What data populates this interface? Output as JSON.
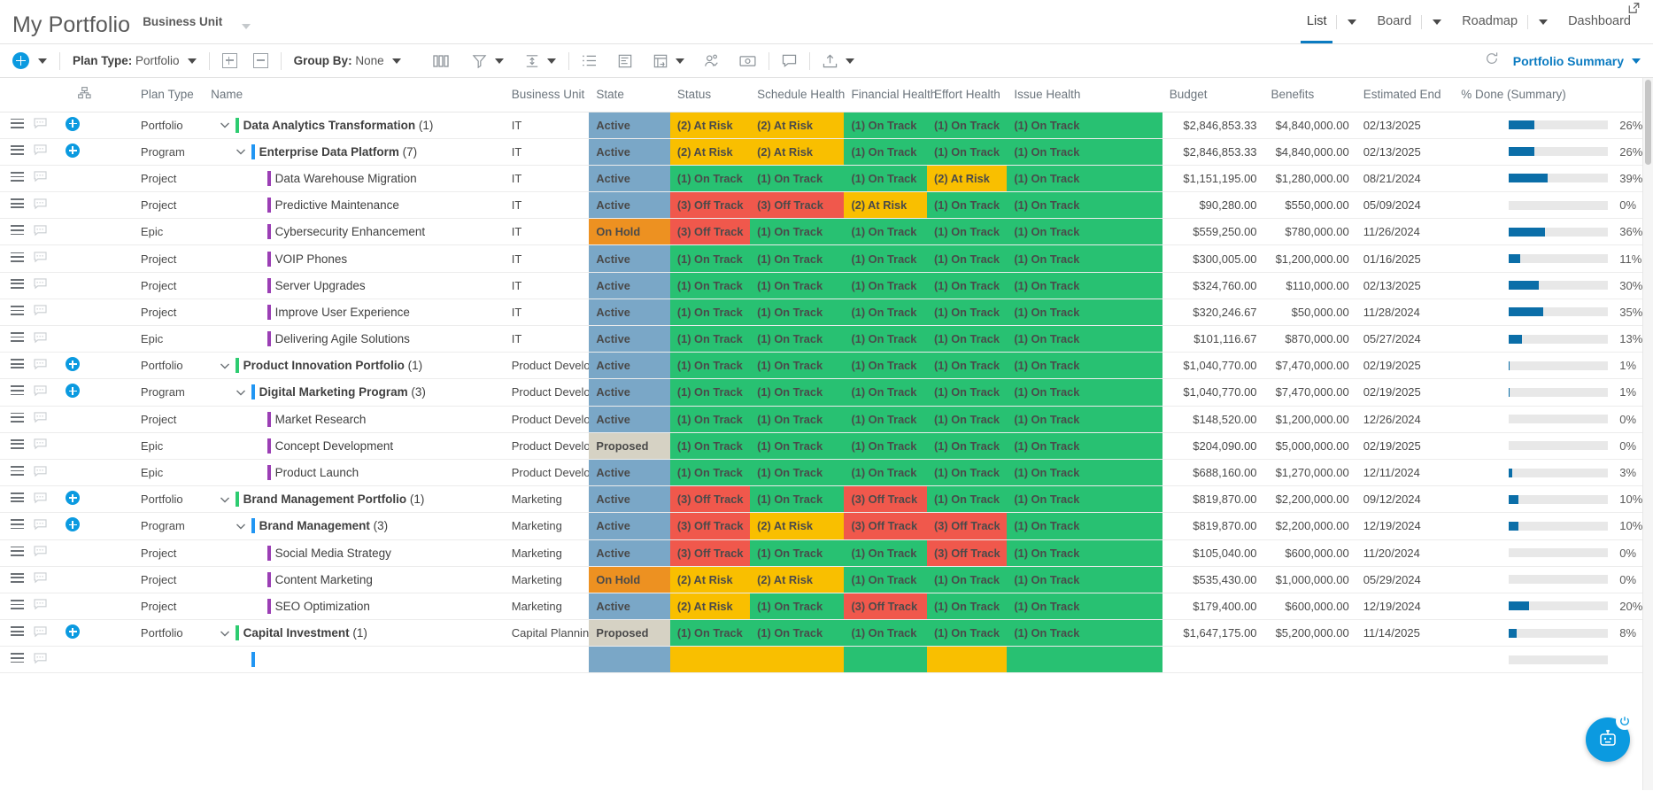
{
  "header": {
    "app_title": "My Portfolio",
    "business_unit_label": "Business Unit",
    "nav": [
      {
        "label": "List",
        "has_caret": true,
        "active": true
      },
      {
        "label": "Board",
        "has_caret": true,
        "active": false
      },
      {
        "label": "Roadmap",
        "has_caret": true,
        "active": false
      },
      {
        "label": "Dashboard",
        "has_caret": false,
        "active": false
      }
    ]
  },
  "toolbar": {
    "plan_type_prefix": "Plan Type:",
    "plan_type_value": "Portfolio",
    "group_by_prefix": "Group By:",
    "group_by_value": "None",
    "portfolio_summary": "Portfolio Summary",
    "icons": [
      "add-circle-icon",
      "columns-icon",
      "filter-icon",
      "row-height-icon",
      "list-icon",
      "baseline-icon",
      "card-view-icon",
      "resource-icon",
      "currency-icon",
      "comment-icon",
      "export-icon",
      "refresh-icon"
    ]
  },
  "table": {
    "columns": [
      {
        "key": "handle",
        "label": ""
      },
      {
        "key": "note",
        "label": ""
      },
      {
        "key": "add",
        "label": "hierarchy-icon"
      },
      {
        "key": "plan_type",
        "label": "Plan Type"
      },
      {
        "key": "name",
        "label": "Name"
      },
      {
        "key": "business_unit",
        "label": "Business Unit"
      },
      {
        "key": "state",
        "label": "State"
      },
      {
        "key": "status",
        "label": "Status"
      },
      {
        "key": "schedule_health",
        "label": "Schedule Health"
      },
      {
        "key": "financial_health",
        "label": "Financial Health"
      },
      {
        "key": "effort_health",
        "label": "Effort Health"
      },
      {
        "key": "issue_health",
        "label": "Issue Health"
      },
      {
        "key": "budget",
        "label": "Budget"
      },
      {
        "key": "benefits",
        "label": "Benefits"
      },
      {
        "key": "estimated_end",
        "label": "Estimated End"
      },
      {
        "key": "pct_done",
        "label": "% Done (Summary)"
      }
    ],
    "rows": [
      {
        "plan_type": "Portfolio",
        "name": "Data Analytics Transformation",
        "count": "(1)",
        "indent": 0,
        "expandable": true,
        "add": true,
        "group": true,
        "bar_color": "#2ecc71",
        "business_unit": "IT",
        "state": "Active",
        "state_color": "blue",
        "status": "(2) At Risk",
        "status_color": "yellow",
        "schedule_health": "(2) At Risk",
        "schedule_color": "yellow",
        "financial_health": "(1) On Track",
        "financial_color": "green",
        "effort_health": "(1) On Track",
        "effort_color": "green",
        "issue_health": "(1) On Track",
        "issue_color": "green",
        "budget": "$2,846,853.33",
        "benefits": "$4,840,000.00",
        "estimated_end": "02/13/2025",
        "pct_done": 26
      },
      {
        "plan_type": "Program",
        "name": "Enterprise Data Platform",
        "count": "(7)",
        "indent": 1,
        "expandable": true,
        "add": true,
        "group": true,
        "bar_color": "#2196f3",
        "business_unit": "IT",
        "state": "Active",
        "state_color": "blue",
        "status": "(2) At Risk",
        "status_color": "yellow",
        "schedule_health": "(2) At Risk",
        "schedule_color": "yellow",
        "financial_health": "(1) On Track",
        "financial_color": "green",
        "effort_health": "(1) On Track",
        "effort_color": "green",
        "issue_health": "(1) On Track",
        "issue_color": "green",
        "budget": "$2,846,853.33",
        "benefits": "$4,840,000.00",
        "estimated_end": "02/13/2025",
        "pct_done": 26
      },
      {
        "plan_type": "Project",
        "name": "Data Warehouse Migration",
        "count": "",
        "indent": 2,
        "expandable": false,
        "add": false,
        "group": false,
        "bar_color": "#9b3fb5",
        "business_unit": "IT",
        "state": "Active",
        "state_color": "blue",
        "status": "(1) On Track",
        "status_color": "green",
        "schedule_health": "(1) On Track",
        "schedule_color": "green",
        "financial_health": "(1) On Track",
        "financial_color": "green",
        "effort_health": "(2) At Risk",
        "effort_color": "yellow",
        "issue_health": "(1) On Track",
        "issue_color": "green",
        "budget": "$1,151,195.00",
        "benefits": "$1,280,000.00",
        "estimated_end": "08/21/2024",
        "pct_done": 39
      },
      {
        "plan_type": "Project",
        "name": "Predictive Maintenance",
        "count": "",
        "indent": 2,
        "expandable": false,
        "add": false,
        "group": false,
        "bar_color": "#9b3fb5",
        "business_unit": "IT",
        "state": "Active",
        "state_color": "blue",
        "status": "(3) Off Track",
        "status_color": "red",
        "schedule_health": "(3) Off Track",
        "schedule_color": "red",
        "financial_health": "(2) At Risk",
        "financial_color": "yellow",
        "effort_health": "(1) On Track",
        "effort_color": "green",
        "issue_health": "(1) On Track",
        "issue_color": "green",
        "budget": "$90,280.00",
        "benefits": "$550,000.00",
        "estimated_end": "05/09/2024",
        "pct_done": 0
      },
      {
        "plan_type": "Epic",
        "name": "Cybersecurity Enhancement",
        "count": "",
        "indent": 2,
        "expandable": false,
        "add": false,
        "group": false,
        "bar_color": "#9b3fb5",
        "business_unit": "IT",
        "state": "On Hold",
        "state_color": "orange",
        "status": "(3) Off Track",
        "status_color": "red",
        "schedule_health": "(1) On Track",
        "schedule_color": "green",
        "financial_health": "(1) On Track",
        "financial_color": "green",
        "effort_health": "(1) On Track",
        "effort_color": "green",
        "issue_health": "(1) On Track",
        "issue_color": "green",
        "budget": "$559,250.00",
        "benefits": "$780,000.00",
        "estimated_end": "11/26/2024",
        "pct_done": 36
      },
      {
        "plan_type": "Project",
        "name": "VOIP Phones",
        "count": "",
        "indent": 2,
        "expandable": false,
        "add": false,
        "group": false,
        "bar_color": "#9b3fb5",
        "business_unit": "IT",
        "state": "Active",
        "state_color": "blue",
        "status": "(1) On Track",
        "status_color": "green",
        "schedule_health": "(1) On Track",
        "schedule_color": "green",
        "financial_health": "(1) On Track",
        "financial_color": "green",
        "effort_health": "(1) On Track",
        "effort_color": "green",
        "issue_health": "(1) On Track",
        "issue_color": "green",
        "budget": "$300,005.00",
        "benefits": "$1,200,000.00",
        "estimated_end": "01/16/2025",
        "pct_done": 11
      },
      {
        "plan_type": "Project",
        "name": "Server Upgrades",
        "count": "",
        "indent": 2,
        "expandable": false,
        "add": false,
        "group": false,
        "bar_color": "#9b3fb5",
        "business_unit": "IT",
        "state": "Active",
        "state_color": "blue",
        "status": "(1) On Track",
        "status_color": "green",
        "schedule_health": "(1) On Track",
        "schedule_color": "green",
        "financial_health": "(1) On Track",
        "financial_color": "green",
        "effort_health": "(1) On Track",
        "effort_color": "green",
        "issue_health": "(1) On Track",
        "issue_color": "green",
        "budget": "$324,760.00",
        "benefits": "$110,000.00",
        "estimated_end": "02/13/2025",
        "pct_done": 30
      },
      {
        "plan_type": "Project",
        "name": "Improve User Experience",
        "count": "",
        "indent": 2,
        "expandable": false,
        "add": false,
        "group": false,
        "bar_color": "#9b3fb5",
        "business_unit": "IT",
        "state": "Active",
        "state_color": "blue",
        "status": "(1) On Track",
        "status_color": "green",
        "schedule_health": "(1) On Track",
        "schedule_color": "green",
        "financial_health": "(1) On Track",
        "financial_color": "green",
        "effort_health": "(1) On Track",
        "effort_color": "green",
        "issue_health": "(1) On Track",
        "issue_color": "green",
        "budget": "$320,246.67",
        "benefits": "$50,000.00",
        "estimated_end": "11/28/2024",
        "pct_done": 35
      },
      {
        "plan_type": "Epic",
        "name": "Delivering Agile Solutions",
        "count": "",
        "indent": 2,
        "expandable": false,
        "add": false,
        "group": false,
        "bar_color": "#9b3fb5",
        "business_unit": "IT",
        "state": "Active",
        "state_color": "blue",
        "status": "(1) On Track",
        "status_color": "green",
        "schedule_health": "(1) On Track",
        "schedule_color": "green",
        "financial_health": "(1) On Track",
        "financial_color": "green",
        "effort_health": "(1) On Track",
        "effort_color": "green",
        "issue_health": "(1) On Track",
        "issue_color": "green",
        "budget": "$101,116.67",
        "benefits": "$870,000.00",
        "estimated_end": "05/27/2024",
        "pct_done": 13
      },
      {
        "plan_type": "Portfolio",
        "name": "Product Innovation Portfolio",
        "count": "(1)",
        "indent": 0,
        "expandable": true,
        "add": true,
        "group": true,
        "bar_color": "#2ecc71",
        "business_unit": "Product Develop",
        "state": "Active",
        "state_color": "blue",
        "status": "(1) On Track",
        "status_color": "green",
        "schedule_health": "(1) On Track",
        "schedule_color": "green",
        "financial_health": "(1) On Track",
        "financial_color": "green",
        "effort_health": "(1) On Track",
        "effort_color": "green",
        "issue_health": "(1) On Track",
        "issue_color": "green",
        "budget": "$1,040,770.00",
        "benefits": "$7,470,000.00",
        "estimated_end": "02/19/2025",
        "pct_done": 1
      },
      {
        "plan_type": "Program",
        "name": "Digital Marketing Program",
        "count": "(3)",
        "indent": 1,
        "expandable": true,
        "add": true,
        "group": true,
        "bar_color": "#2196f3",
        "business_unit": "Product Develop",
        "state": "Active",
        "state_color": "blue",
        "status": "(1) On Track",
        "status_color": "green",
        "schedule_health": "(1) On Track",
        "schedule_color": "green",
        "financial_health": "(1) On Track",
        "financial_color": "green",
        "effort_health": "(1) On Track",
        "effort_color": "green",
        "issue_health": "(1) On Track",
        "issue_color": "green",
        "budget": "$1,040,770.00",
        "benefits": "$7,470,000.00",
        "estimated_end": "02/19/2025",
        "pct_done": 1
      },
      {
        "plan_type": "Project",
        "name": "Market Research",
        "count": "",
        "indent": 2,
        "expandable": false,
        "add": false,
        "group": false,
        "bar_color": "#9b3fb5",
        "business_unit": "Product Develop",
        "state": "Active",
        "state_color": "blue",
        "status": "(1) On Track",
        "status_color": "green",
        "schedule_health": "(1) On Track",
        "schedule_color": "green",
        "financial_health": "(1) On Track",
        "financial_color": "green",
        "effort_health": "(1) On Track",
        "effort_color": "green",
        "issue_health": "(1) On Track",
        "issue_color": "green",
        "budget": "$148,520.00",
        "benefits": "$1,200,000.00",
        "estimated_end": "12/26/2024",
        "pct_done": 0
      },
      {
        "plan_type": "Epic",
        "name": "Concept Development",
        "count": "",
        "indent": 2,
        "expandable": false,
        "add": false,
        "group": false,
        "bar_color": "#9b3fb5",
        "business_unit": "Product Develop",
        "state": "Proposed",
        "state_color": "grey",
        "status": "(1) On Track",
        "status_color": "green",
        "schedule_health": "(1) On Track",
        "schedule_color": "green",
        "financial_health": "(1) On Track",
        "financial_color": "green",
        "effort_health": "(1) On Track",
        "effort_color": "green",
        "issue_health": "(1) On Track",
        "issue_color": "green",
        "budget": "$204,090.00",
        "benefits": "$5,000,000.00",
        "estimated_end": "02/19/2025",
        "pct_done": 0
      },
      {
        "plan_type": "Epic",
        "name": "Product Launch",
        "count": "",
        "indent": 2,
        "expandable": false,
        "add": false,
        "group": false,
        "bar_color": "#9b3fb5",
        "business_unit": "Product Develop",
        "state": "Active",
        "state_color": "blue",
        "status": "(1) On Track",
        "status_color": "green",
        "schedule_health": "(1) On Track",
        "schedule_color": "green",
        "financial_health": "(1) On Track",
        "financial_color": "green",
        "effort_health": "(1) On Track",
        "effort_color": "green",
        "issue_health": "(1) On Track",
        "issue_color": "green",
        "budget": "$688,160.00",
        "benefits": "$1,270,000.00",
        "estimated_end": "12/11/2024",
        "pct_done": 3
      },
      {
        "plan_type": "Portfolio",
        "name": "Brand Management Portfolio",
        "count": "(1)",
        "indent": 0,
        "expandable": true,
        "add": true,
        "group": true,
        "bar_color": "#2ecc71",
        "business_unit": "Marketing",
        "state": "Active",
        "state_color": "blue",
        "status": "(3) Off Track",
        "status_color": "red",
        "schedule_health": "(1) On Track",
        "schedule_color": "green",
        "financial_health": "(3) Off Track",
        "financial_color": "red",
        "effort_health": "(1) On Track",
        "effort_color": "green",
        "issue_health": "(1) On Track",
        "issue_color": "green",
        "budget": "$819,870.00",
        "benefits": "$2,200,000.00",
        "estimated_end": "09/12/2024",
        "pct_done": 10
      },
      {
        "plan_type": "Program",
        "name": "Brand Management",
        "count": "(3)",
        "indent": 1,
        "expandable": true,
        "add": true,
        "group": true,
        "bar_color": "#2196f3",
        "business_unit": "Marketing",
        "state": "Active",
        "state_color": "blue",
        "status": "(3) Off Track",
        "status_color": "red",
        "schedule_health": "(2) At Risk",
        "schedule_color": "yellow",
        "financial_health": "(3) Off Track",
        "financial_color": "red",
        "effort_health": "(3) Off Track",
        "effort_color": "red",
        "issue_health": "(1) On Track",
        "issue_color": "green",
        "budget": "$819,870.00",
        "benefits": "$2,200,000.00",
        "estimated_end": "12/19/2024",
        "pct_done": 10
      },
      {
        "plan_type": "Project",
        "name": "Social Media Strategy",
        "count": "",
        "indent": 2,
        "expandable": false,
        "add": false,
        "group": false,
        "bar_color": "#9b3fb5",
        "business_unit": "Marketing",
        "state": "Active",
        "state_color": "blue",
        "status": "(3) Off Track",
        "status_color": "red",
        "schedule_health": "(1) On Track",
        "schedule_color": "green",
        "financial_health": "(1) On Track",
        "financial_color": "green",
        "effort_health": "(3) Off Track",
        "effort_color": "red",
        "issue_health": "(1) On Track",
        "issue_color": "green",
        "budget": "$105,040.00",
        "benefits": "$600,000.00",
        "estimated_end": "11/20/2024",
        "pct_done": 0
      },
      {
        "plan_type": "Project",
        "name": "Content Marketing",
        "count": "",
        "indent": 2,
        "expandable": false,
        "add": false,
        "group": false,
        "bar_color": "#9b3fb5",
        "business_unit": "Marketing",
        "state": "On Hold",
        "state_color": "orange",
        "status": "(2) At Risk",
        "status_color": "yellow",
        "schedule_health": "(2) At Risk",
        "schedule_color": "yellow",
        "financial_health": "(1) On Track",
        "financial_color": "green",
        "effort_health": "(1) On Track",
        "effort_color": "green",
        "issue_health": "(1) On Track",
        "issue_color": "green",
        "budget": "$535,430.00",
        "benefits": "$1,000,000.00",
        "estimated_end": "05/29/2024",
        "pct_done": 0
      },
      {
        "plan_type": "Project",
        "name": "SEO Optimization",
        "count": "",
        "indent": 2,
        "expandable": false,
        "add": false,
        "group": false,
        "bar_color": "#9b3fb5",
        "business_unit": "Marketing",
        "state": "Active",
        "state_color": "blue",
        "status": "(2) At Risk",
        "status_color": "yellow",
        "schedule_health": "(1) On Track",
        "schedule_color": "green",
        "financial_health": "(3) Off Track",
        "financial_color": "red",
        "effort_health": "(1) On Track",
        "effort_color": "green",
        "issue_health": "(1) On Track",
        "issue_color": "green",
        "budget": "$179,400.00",
        "benefits": "$600,000.00",
        "estimated_end": "12/19/2024",
        "pct_done": 20
      },
      {
        "plan_type": "Portfolio",
        "name": "Capital Investment",
        "count": "(1)",
        "indent": 0,
        "expandable": true,
        "add": true,
        "group": true,
        "bar_color": "#2ecc71",
        "business_unit": "Capital Planning",
        "state": "Proposed",
        "state_color": "grey",
        "status": "(1) On Track",
        "status_color": "green",
        "schedule_health": "(1) On Track",
        "schedule_color": "green",
        "financial_health": "(1) On Track",
        "financial_color": "green",
        "effort_health": "(1) On Track",
        "effort_color": "green",
        "issue_health": "(1) On Track",
        "issue_color": "green",
        "budget": "$1,647,175.00",
        "benefits": "$5,200,000.00",
        "estimated_end": "11/14/2025",
        "pct_done": 8
      },
      {
        "plan_type": "",
        "name": "",
        "count": "",
        "indent": 1,
        "expandable": false,
        "add": false,
        "group": false,
        "bar_color": "#2196f3",
        "business_unit": "",
        "state": "",
        "state_color": "blue",
        "status": "",
        "status_color": "yellow",
        "schedule_health": "",
        "schedule_color": "yellow",
        "financial_health": "",
        "financial_color": "green",
        "effort_health": "",
        "effort_color": "yellow",
        "issue_health": "",
        "issue_color": "green",
        "budget": "",
        "benefits": "",
        "estimated_end": "",
        "pct_done": 0
      }
    ]
  },
  "assistant": {
    "bot_label": "bot-icon",
    "power_label": "power-icon"
  }
}
